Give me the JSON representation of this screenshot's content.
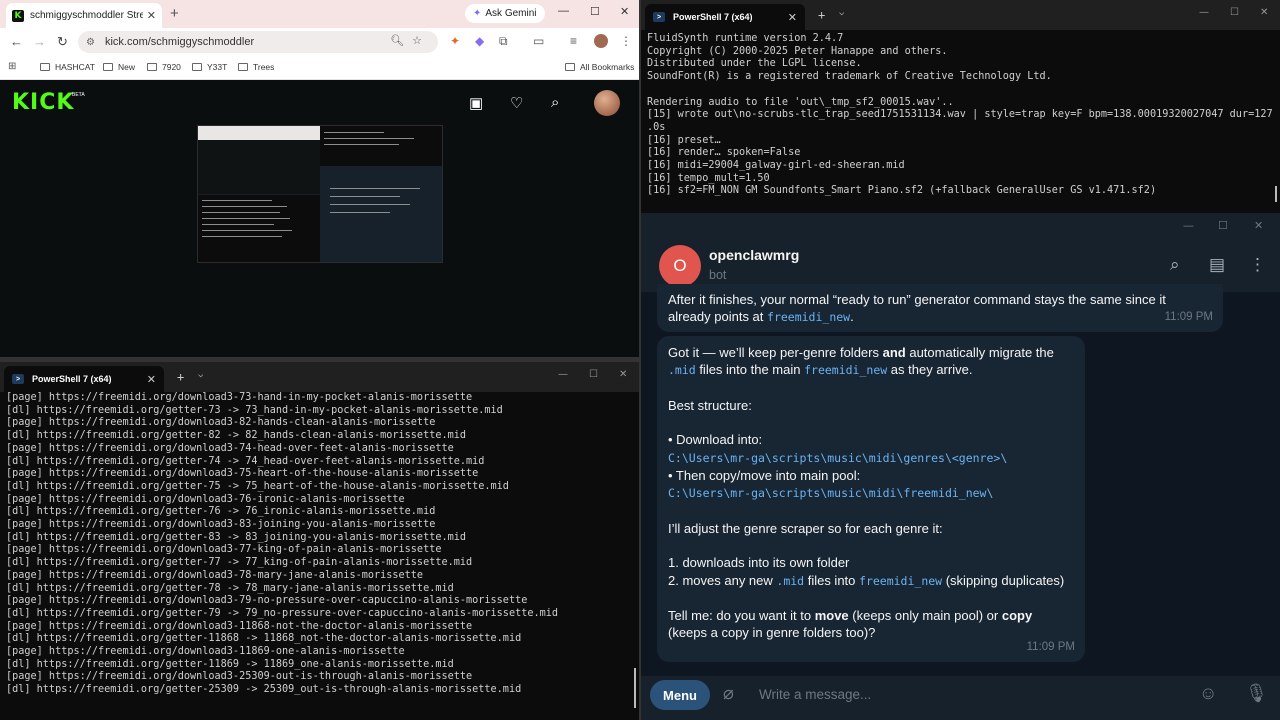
{
  "browser": {
    "tab_title": "schmiggyschmoddler Stream -",
    "tab_close": "✕",
    "new_tab": "+",
    "gemini_label": "Ask Gemini",
    "url": "kick.com/schmiggyschmoddler",
    "bookmarks": [
      "HASHCAT",
      "New",
      "7920",
      "Y33T",
      "Trees"
    ],
    "all_bookmarks": "All Bookmarks",
    "kick_logo": "KICK",
    "kick_beta": "BETA"
  },
  "ps_top": {
    "tab_title": "PowerShell 7 (x64)",
    "lines": [
      "FluidSynth runtime version 2.4.7",
      "Copyright (C) 2000-2025 Peter Hanappe and others.",
      "Distributed under the LGPL license.",
      "SoundFont(R) is a registered trademark of Creative Technology Ltd.",
      "",
      "Rendering audio to file 'out\\_tmp_sf2_00015.wav'..",
      "[15] wrote out\\no-scrubs-tlc_trap_seed1751531134.wav | style=trap key=F bpm=138.00019320027047 dur=127",
      ".0s",
      "[16] preset…",
      "[16] render… spoken=False",
      "[16] midi=29004_galway-girl-ed-sheeran.mid",
      "[16] tempo_mult=1.50",
      "[16] sf2=FM_NON GM Soundfonts_Smart Piano.sf2 (+fallback GeneralUser GS v1.471.sf2)",
      ""
    ]
  },
  "ps_bottom": {
    "tab_title": "PowerShell 7 (x64)",
    "lines": [
      "[page] https://freemidi.org/download3-73-hand-in-my-pocket-alanis-morissette",
      "[dl] https://freemidi.org/getter-73 -> 73_hand-in-my-pocket-alanis-morissette.mid",
      "[page] https://freemidi.org/download3-82-hands-clean-alanis-morissette",
      "[dl] https://freemidi.org/getter-82 -> 82_hands-clean-alanis-morissette.mid",
      "[page] https://freemidi.org/download3-74-head-over-feet-alanis-morissette",
      "[dl] https://freemidi.org/getter-74 -> 74_head-over-feet-alanis-morissette.mid",
      "[page] https://freemidi.org/download3-75-heart-of-the-house-alanis-morissette",
      "[dl] https://freemidi.org/getter-75 -> 75_heart-of-the-house-alanis-morissette.mid",
      "[page] https://freemidi.org/download3-76-ironic-alanis-morissette",
      "[dl] https://freemidi.org/getter-76 -> 76_ironic-alanis-morissette.mid",
      "[page] https://freemidi.org/download3-83-joining-you-alanis-morissette",
      "[dl] https://freemidi.org/getter-83 -> 83_joining-you-alanis-morissette.mid",
      "[page] https://freemidi.org/download3-77-king-of-pain-alanis-morissette",
      "[dl] https://freemidi.org/getter-77 -> 77_king-of-pain-alanis-morissette.mid",
      "[page] https://freemidi.org/download3-78-mary-jane-alanis-morissette",
      "[dl] https://freemidi.org/getter-78 -> 78_mary-jane-alanis-morissette.mid",
      "[page] https://freemidi.org/download3-79-no-pressure-over-capuccino-alanis-morissette",
      "[dl] https://freemidi.org/getter-79 -> 79_no-pressure-over-capuccino-alanis-morissette.mid",
      "[page] https://freemidi.org/download3-11868-not-the-doctor-alanis-morissette",
      "[dl] https://freemidi.org/getter-11868 -> 11868_not-the-doctor-alanis-morissette.mid",
      "[page] https://freemidi.org/download3-11869-one-alanis-morissette",
      "[dl] https://freemidi.org/getter-11869 -> 11869_one-alanis-morissette.mid",
      "[page] https://freemidi.org/download3-25309-out-is-through-alanis-morissette",
      "[dl] https://freemidi.org/getter-25309 -> 25309_out-is-through-alanis-morissette.mid"
    ]
  },
  "telegram": {
    "avatar_letter": "O",
    "chat_name": "openclawmrg",
    "chat_status": "bot",
    "msg1": {
      "text_a": "After it finishes, your normal “ready to run” generator command stays the same since it already points at ",
      "code_a": "freemidi_new",
      "text_b": ".",
      "time": "11:09 PM"
    },
    "msg2": {
      "p1_a": "Got it — we’ll keep per-genre folders ",
      "p1_bold": "and",
      "p1_b": " automatically migrate the ",
      "p1_code1": ".mid",
      "p1_c": " files into the main ",
      "p1_code2": "freemidi_new",
      "p1_d": " as they arrive.",
      "p2": "Best structure:",
      "p3_a": "• Download into:",
      "p3_code1": "C:\\Users\\mr-ga\\scripts\\music\\midi\\genres\\<genre>\\",
      "p3_b": "• Then copy/move into main pool:",
      "p3_code2": "C:\\Users\\mr-ga\\scripts\\music\\midi\\freemidi_new\\",
      "p4": "I’ll adjust the genre scraper so for each genre it:",
      "p5_a": "1. downloads into its own folder",
      "p5_b": "2. moves any new ",
      "p5_code1": ".mid",
      "p5_c": " files into ",
      "p5_code2": "freemidi_new",
      "p5_d": " (skipping duplicates)",
      "p6_a": "Tell me: do you want it to ",
      "p6_bold1": "move",
      "p6_b": " (keeps only main pool) or ",
      "p6_bold2": "copy",
      "p6_c": " (keeps a copy in genre folders too)?",
      "time": "11:09 PM"
    },
    "menu_label": "Menu",
    "input_placeholder": "Write a message..."
  },
  "colors": {
    "kick_green": "#53fc18",
    "tg_bg": "#0e1621",
    "tg_bubble": "#182533",
    "tg_link": "#6ab3f3",
    "terminal_bg": "#0c0c0c"
  }
}
